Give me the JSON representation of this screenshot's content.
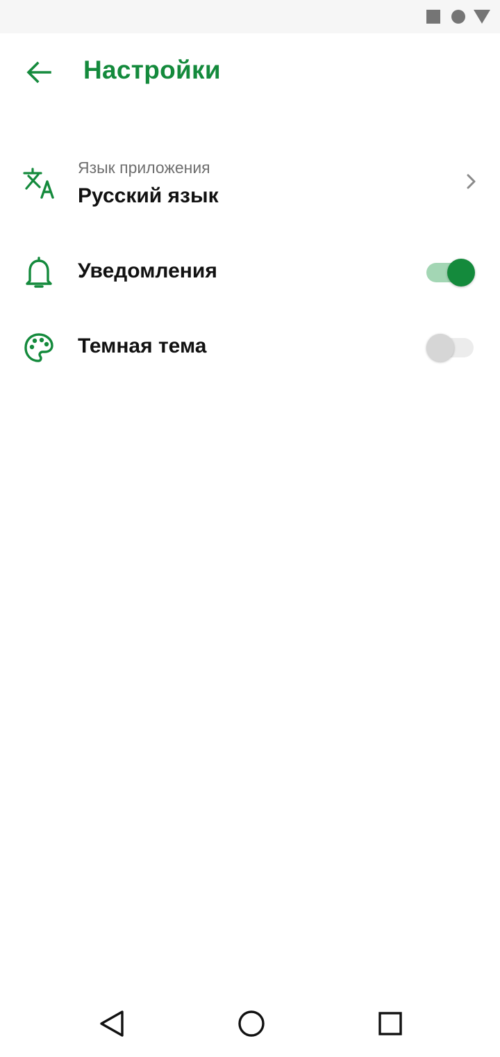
{
  "status_bar": {
    "icons": [
      "square-icon",
      "circle-icon",
      "triangle-icon"
    ]
  },
  "header": {
    "back_icon": "arrow-left-icon",
    "title": "Настройки"
  },
  "settings": {
    "language": {
      "icon": "translate-icon",
      "subtitle": "Язык приложения",
      "value": "Русский язык",
      "chevron_icon": "chevron-right-icon"
    },
    "notifications": {
      "icon": "bell-icon",
      "label": "Уведомления",
      "enabled": true
    },
    "dark_theme": {
      "icon": "palette-icon",
      "label": "Темная тема",
      "enabled": false
    }
  },
  "nav_bar": {
    "icons": [
      "nav-back-icon",
      "nav-home-icon",
      "nav-recents-icon"
    ]
  },
  "colors": {
    "accent": "#148a3c",
    "switch_track_on": "#a3d6b4",
    "switch_thumb_off": "#d6d6d6",
    "text_primary": "#111111",
    "text_secondary": "#6f6f6f"
  }
}
